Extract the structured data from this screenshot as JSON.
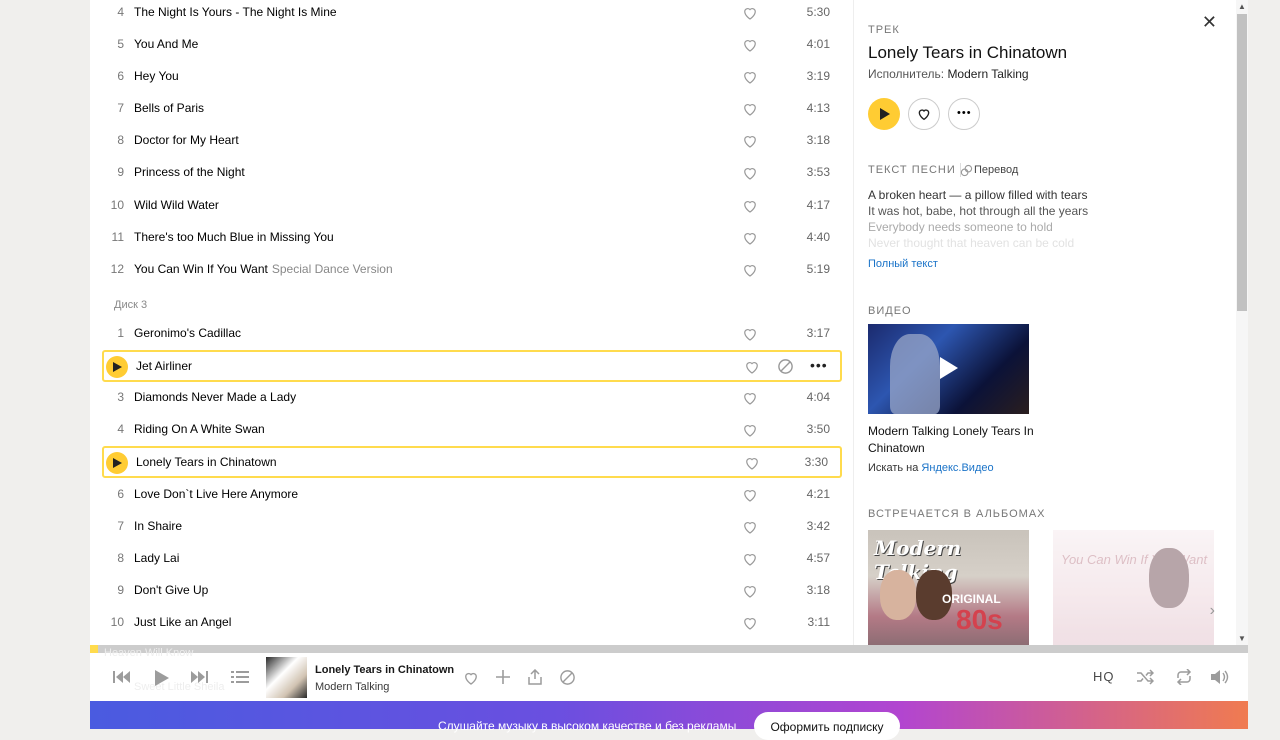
{
  "disc_label": "Диск 3",
  "tracks_top": [
    {
      "num": "4",
      "title": "The Night Is Yours - The Night Is Mine",
      "version": "",
      "duration": "5:30"
    },
    {
      "num": "5",
      "title": "You And Me",
      "version": "",
      "duration": "4:01"
    },
    {
      "num": "6",
      "title": "Hey You",
      "version": "",
      "duration": "3:19"
    },
    {
      "num": "7",
      "title": "Bells of Paris",
      "version": "",
      "duration": "4:13"
    },
    {
      "num": "8",
      "title": "Doctor for My Heart",
      "version": "",
      "duration": "3:18"
    },
    {
      "num": "9",
      "title": "Princess of the Night",
      "version": "",
      "duration": "3:53"
    },
    {
      "num": "10",
      "title": "Wild Wild Water",
      "version": "",
      "duration": "4:17"
    },
    {
      "num": "11",
      "title": "There's too Much Blue in Missing You",
      "version": "",
      "duration": "4:40"
    },
    {
      "num": "12",
      "title": "You Can Win If You Want",
      "version": "Special Dance Version",
      "duration": "5:19"
    }
  ],
  "tracks_disc3": [
    {
      "num": "1",
      "title": "Geronimo's Cadillac",
      "duration": "3:17"
    },
    {
      "num": "",
      "title": "Jet Airliner",
      "duration": ""
    },
    {
      "num": "3",
      "title": "Diamonds Never Made a Lady",
      "duration": "4:04"
    },
    {
      "num": "4",
      "title": "Riding On A White Swan",
      "duration": "3:50"
    },
    {
      "num": "",
      "title": "Lonely Tears in Chinatown",
      "duration": "3:30"
    },
    {
      "num": "6",
      "title": "Love Don`t Live Here Anymore",
      "duration": "4:21"
    },
    {
      "num": "7",
      "title": "In Shaire",
      "duration": "3:42"
    },
    {
      "num": "8",
      "title": "Lady Lai",
      "duration": "4:57"
    },
    {
      "num": "9",
      "title": "Don't Give Up",
      "duration": "3:18"
    },
    {
      "num": "10",
      "title": "Just Like an Angel",
      "duration": "3:11"
    }
  ],
  "faded_tracks": [
    "Heaven Will Know",
    "Sweet Little Sheila"
  ],
  "sidebar": {
    "section_label": "ТРЕК",
    "track_title": "Lonely Tears in Chinatown",
    "artist_prefix": "Исполнитель:",
    "artist": "Modern Talking",
    "lyrics_label": "ТЕКСТ ПЕСНИ",
    "translation_label": "Перевод",
    "lyrics": [
      "A broken heart — a pillow filled with tears",
      "It was hot, babe, hot through all the years",
      "Everybody needs someone to hold",
      "Never thought that heaven can be cold"
    ],
    "full_text_link": "Полный текст",
    "video_label": "ВИДЕО",
    "video_title": "Modern Talking Lonely Tears In Chinatown",
    "video_search_prefix": "Искать на",
    "video_search_link": "Яндекс.Видео",
    "albums_label": "ВСТРЕЧАЕТСЯ В АЛЬБОМАХ",
    "album1": {
      "title": "Modern Talking",
      "sub1": "ORIGINAL",
      "sub2": "80s"
    },
    "album2": {
      "title": "You Can Win If You Want"
    }
  },
  "player": {
    "track_title": "Lonely Tears in Chinatown",
    "artist": "Modern Talking",
    "quality_label": "HQ",
    "progress": 0.007
  },
  "banner": {
    "text": "Слушайте музыку в высоком качестве и без рекламы",
    "button": "Оформить подписку"
  },
  "colors": {
    "accent": "#ffcc33",
    "link": "#1a73c8",
    "highlight_border": "#ffdb4d"
  }
}
